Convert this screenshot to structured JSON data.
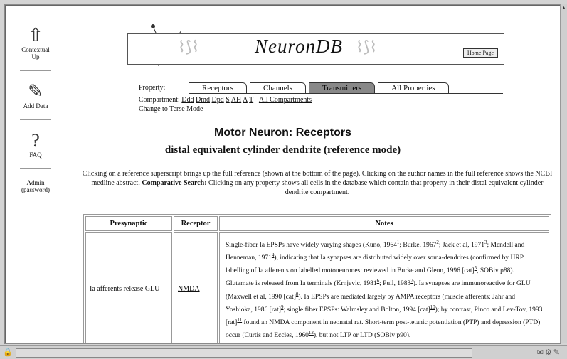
{
  "nav": {
    "contextual_up": "Contextual Up",
    "add_data": "Add Data",
    "faq": "FAQ",
    "admin": "Admin",
    "admin_note": "(password)"
  },
  "banner": {
    "brand": "NeuronDB",
    "home_page": "Home Page"
  },
  "property": {
    "label": "Property:",
    "tabs": [
      "Receptors",
      "Channels",
      "Transmitters",
      "All Properties"
    ],
    "active_tab": "Transmitters"
  },
  "compartment": {
    "label": "Compartment:",
    "items": [
      "Ddd",
      "Dmd",
      "Dpd",
      "S",
      "AH",
      "A",
      "T"
    ],
    "separator": "-",
    "all": "All Compartments"
  },
  "mode": {
    "label": "Change to",
    "link": "Terse Mode"
  },
  "page": {
    "title": "Motor Neuron: Receptors",
    "subtitle": "distal equivalent cylinder dendrite (reference mode)",
    "intro_1": "Clicking on a reference superscript brings up the full reference (shown at the bottom of the page). Clicking on the author names in the full reference shows the NCBI medline abstract.",
    "intro_bold": "Comparative Search:",
    "intro_2": "Clicking on any property shows all cells in the database which contain that property in their distal equivalent cylinder dendrite compartment."
  },
  "table": {
    "headers": [
      "Presynaptic",
      "Receptor",
      "Notes"
    ],
    "row": {
      "presynaptic": "Ia afferents release GLU",
      "receptor": "NMDA",
      "notes_parts": [
        "Single-fiber Ia EPSPs have widely varying shapes (Kuno, 1964",
        "; Burke, 1967",
        "; Jack et al, 1971",
        ";",
        "Mendell and Henneman, 1971",
        "), indicating that Ia synapses are distributed widely over soma-dendrites (confirmed by HRP labelling of Ia afferents on labelled motoneurones: reviewed in Burke and Glenn, 1996 [cat]",
        ", SOBiv p88). Glutamate is released from Ia terminals (Krnjevic, 1981",
        "; Puil, 1983",
        "). Ia synapses are immunoreactive for GLU (Maxwell et al, 1990 [cat]",
        "). Ia EPSPs are mediated largely by AMPA receptors (muscle afferents: Jahr and Yoshioka, 1986 [rat]",
        "; single fiber EPSPs: Walmsley and Bolton, 1994 [cat]",
        "); by contrast, Pinco and Lev-Tov, 1993 [rat]",
        " found an NMDA component in neonatal rat. Short-term post-tetanic potentiation (PTP) and depression (PTD) occur (Curtis and Eccles, 1960",
        "), but not LTP or LTD (SOBiv p90)."
      ],
      "refs": [
        "1",
        "2",
        "3",
        "4",
        "5",
        "6",
        "7",
        "8",
        "9",
        "10",
        "11",
        "12"
      ]
    }
  }
}
